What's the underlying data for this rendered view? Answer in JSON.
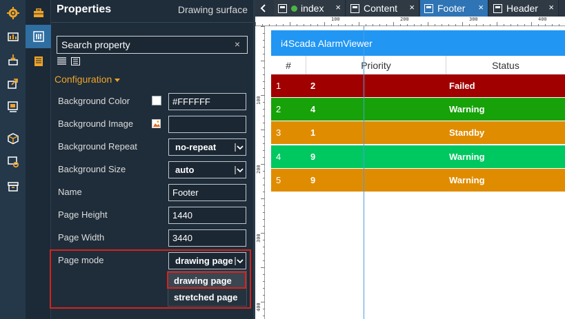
{
  "rail_primary": {
    "icons": [
      "settings-icon",
      "toolbox-icon",
      "import-icon",
      "export-icon",
      "display-icon",
      "package-icon",
      "config-icon",
      "archive-icon"
    ]
  },
  "rail_secondary": {
    "icons": [
      "briefcase-icon",
      "properties-icon",
      "notes-icon"
    ]
  },
  "properties_panel": {
    "title": "Properties",
    "subtitle": "Drawing surface",
    "search_placeholder": "Search property",
    "search_clear": "×",
    "section": "Configuration",
    "rows": [
      {
        "label": "Background Color",
        "value": "#FFFFFF",
        "swatch": "#FFFFFF"
      },
      {
        "label": "Background Image",
        "value": ""
      },
      {
        "label": "Background Repeat",
        "value": "no-repeat"
      },
      {
        "label": "Background Size",
        "value": "auto"
      },
      {
        "label": "Name",
        "value": "Footer"
      },
      {
        "label": "Page Height",
        "value": "1440"
      },
      {
        "label": "Page Width",
        "value": "3440"
      },
      {
        "label": "Page mode",
        "value": "drawing page"
      }
    ],
    "page_mode_options": [
      "drawing page",
      "stretched page"
    ],
    "page_mode_selected": "drawing page"
  },
  "tabs": [
    {
      "label": "index",
      "close": "×",
      "active": false,
      "status_color": "#4cb542"
    },
    {
      "label": "Content",
      "close": "×",
      "active": false
    },
    {
      "label": "Footer",
      "close": "×",
      "active": true
    },
    {
      "label": "Header",
      "close": "×",
      "active": false
    }
  ],
  "ruler": {
    "horizontal_ticks": [
      "100",
      "200",
      "300",
      "400"
    ],
    "vertical_ticks": [
      "100",
      "200",
      "300",
      "400"
    ]
  },
  "alarm_viewer": {
    "title": "i4Scada AlarmViewer",
    "columns": [
      "#",
      "Priority",
      "Status"
    ],
    "rows": [
      {
        "num": "1",
        "priority": "2",
        "status": "Failed",
        "color": "#a00000"
      },
      {
        "num": "2",
        "priority": "4",
        "status": "Warning",
        "color": "#17a20a"
      },
      {
        "num": "3",
        "priority": "1",
        "status": "Standby",
        "color": "#e08c00"
      },
      {
        "num": "4",
        "priority": "9",
        "status": "Warning",
        "color": "#00c860"
      },
      {
        "num": "5",
        "priority": "9",
        "status": "Warning",
        "color": "#e08c00"
      }
    ]
  }
}
